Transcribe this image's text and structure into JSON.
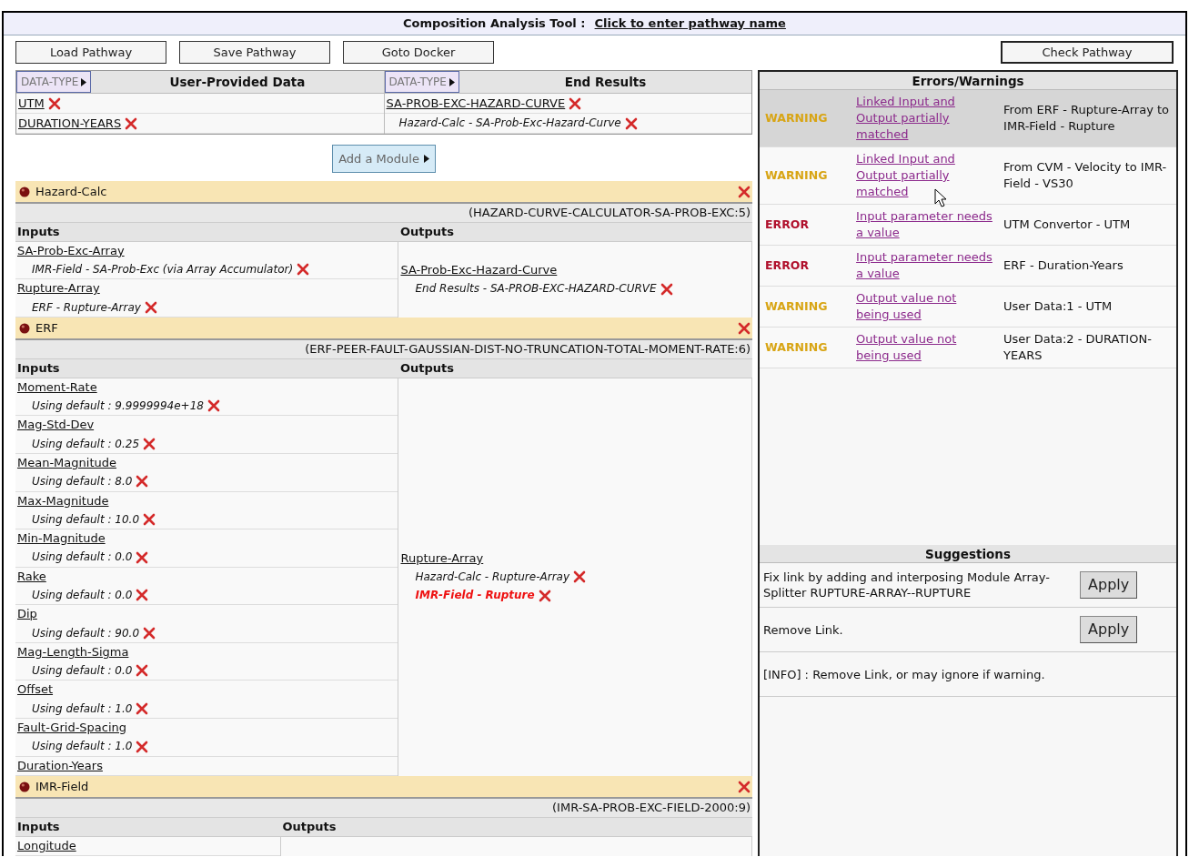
{
  "title": {
    "label": "Composition Analysis Tool :",
    "link": "Click to enter pathway name"
  },
  "toolbar": {
    "buttons": [
      "Load Pathway",
      "Save Pathway",
      "Goto Docker"
    ],
    "check_button": "Check Pathway"
  },
  "data_panels": [
    {
      "type_button": "DATA-TYPE",
      "heading": "User-Provided Data",
      "items": [
        {
          "label": "UTM",
          "kind": "data"
        },
        {
          "label": "DURATION-YEARS",
          "kind": "data"
        }
      ]
    },
    {
      "type_button": "DATA-TYPE",
      "heading": "End Results",
      "items": [
        {
          "label": "SA-PROB-EXC-HAZARD-CURVE",
          "kind": "data"
        },
        {
          "label": "Hazard-Calc - SA-Prob-Exc-Hazard-Curve",
          "kind": "link"
        }
      ]
    }
  ],
  "add_module": "Add a Module",
  "modules": [
    {
      "name": "Hazard-Calc",
      "id": "(HAZARD-CURVE-CALCULATOR-SA-PROB-EXC:5)",
      "inputs_heading": "Inputs",
      "outputs_heading": "Outputs",
      "inputs": [
        {
          "name": "SA-Prob-Exc-Array",
          "links": [
            {
              "text": "IMR-Field - SA-Prob-Exc (via Array Accumulator)",
              "highlighted": false
            }
          ]
        },
        {
          "name": "Rupture-Array",
          "links": [
            {
              "text": "ERF - Rupture-Array",
              "highlighted": false
            }
          ]
        }
      ],
      "outputs": [
        {
          "name": "SA-Prob-Exc-Hazard-Curve",
          "links": [
            {
              "text": "End Results - SA-PROB-EXC-HAZARD-CURVE",
              "highlighted": false
            }
          ]
        }
      ]
    },
    {
      "name": "ERF",
      "id": "(ERF-PEER-FAULT-GAUSSIAN-DIST-NO-TRUNCATION-TOTAL-MOMENT-RATE:6)",
      "inputs_heading": "Inputs",
      "outputs_heading": "Outputs",
      "inputs": [
        {
          "name": "Moment-Rate",
          "links": [
            {
              "text": "Using default : 9.9999994e+18",
              "highlighted": false
            }
          ]
        },
        {
          "name": "Mag-Std-Dev",
          "links": [
            {
              "text": "Using default : 0.25",
              "highlighted": false
            }
          ]
        },
        {
          "name": "Mean-Magnitude",
          "links": [
            {
              "text": "Using default : 8.0",
              "highlighted": false
            }
          ]
        },
        {
          "name": "Max-Magnitude",
          "links": [
            {
              "text": "Using default : 10.0",
              "highlighted": false
            }
          ]
        },
        {
          "name": "Min-Magnitude",
          "links": [
            {
              "text": "Using default : 0.0",
              "highlighted": false
            }
          ]
        },
        {
          "name": "Rake",
          "links": [
            {
              "text": "Using default : 0.0",
              "highlighted": false
            }
          ]
        },
        {
          "name": "Dip",
          "links": [
            {
              "text": "Using default : 90.0",
              "highlighted": false
            }
          ]
        },
        {
          "name": "Mag-Length-Sigma",
          "links": [
            {
              "text": "Using default : 0.0",
              "highlighted": false
            }
          ]
        },
        {
          "name": "Offset",
          "links": [
            {
              "text": "Using default : 1.0",
              "highlighted": false
            }
          ]
        },
        {
          "name": "Fault-Grid-Spacing",
          "links": [
            {
              "text": "Using default : 1.0",
              "highlighted": false
            }
          ]
        },
        {
          "name": "Duration-Years"
        }
      ],
      "outputs": [
        {
          "name": "Rupture-Array",
          "links": [
            {
              "text": "Hazard-Calc - Rupture-Array",
              "highlighted": false
            },
            {
              "text": "IMR-Field - Rupture",
              "highlighted": true
            }
          ]
        }
      ]
    },
    {
      "name": "IMR-Field",
      "id": "(IMR-SA-PROB-EXC-FIELD-2000:9)",
      "inputs_heading": "Inputs",
      "outputs_heading": "Outputs",
      "inputs": [
        {
          "name": "Longitude"
        }
      ]
    }
  ],
  "errors": {
    "heading": "Errors/Warnings",
    "rows": [
      {
        "level": "WARNING",
        "kind": "warning",
        "message": "Linked Input and Output partially matched",
        "source": "From ERF - Rupture-Array to IMR-Field - Rupture",
        "selected": true
      },
      {
        "level": "WARNING",
        "kind": "warning",
        "message": "Linked Input and Output partially matched",
        "source": "From CVM - Velocity to IMR-Field - VS30",
        "selected": false
      },
      {
        "level": "ERROR",
        "kind": "error",
        "message": "Input parameter needs a value",
        "source": "UTM Convertor - UTM",
        "selected": false
      },
      {
        "level": "ERROR",
        "kind": "error",
        "message": "Input parameter needs a value",
        "source": "ERF - Duration-Years",
        "selected": false
      },
      {
        "level": "WARNING",
        "kind": "warning",
        "message": "Output value not being used",
        "source": "User Data:1 - UTM",
        "selected": false
      },
      {
        "level": "WARNING",
        "kind": "warning",
        "message": "Output value not being used",
        "source": "User Data:2 - DURATION-YEARS",
        "selected": false
      }
    ]
  },
  "suggestions": {
    "heading": "Suggestions",
    "items": [
      {
        "text": "Fix link by adding and interposing Module Array-Splitter RUPTURE-ARRAY--RUPTURE",
        "button": "Apply"
      },
      {
        "text": "Remove Link.",
        "button": "Apply"
      },
      {
        "text": "[INFO] : Remove Link, or may ignore if warning."
      }
    ]
  }
}
